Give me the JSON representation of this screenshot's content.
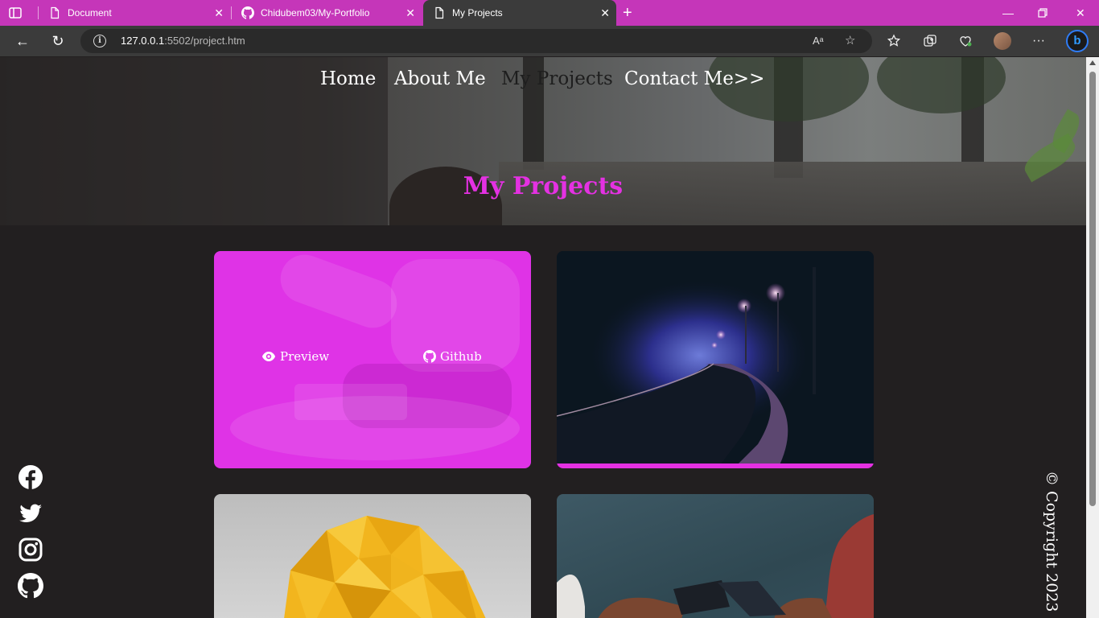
{
  "browser": {
    "tabs": [
      {
        "title": "Document",
        "icon": "document-icon"
      },
      {
        "title": "Chidubem03/My-Portfolio",
        "icon": "github-icon"
      },
      {
        "title": "My Projects",
        "icon": "document-icon",
        "active": true
      }
    ],
    "tab_close_glyph": "✕",
    "new_tab_glyph": "+",
    "url_host": "127.0.0.1",
    "url_rest": ":5502/project.htm",
    "accent_color": "#c536b9"
  },
  "site": {
    "nav": [
      {
        "label": "Home"
      },
      {
        "label": "About Me"
      },
      {
        "label": "My Projects",
        "current": true
      },
      {
        "label": "Contact Me>>"
      }
    ],
    "page_title": "My Projects",
    "accent_color": "#e431e2",
    "projects": [
      {
        "preview_label": "Preview",
        "github_label": "Github",
        "state": "hover"
      },
      {
        "image": "night-road"
      },
      {
        "image": "yellow-origami"
      },
      {
        "image": "hands-smartphone"
      }
    ],
    "socials": [
      "facebook-icon",
      "twitter-icon",
      "instagram-icon",
      "github-icon"
    ],
    "copyright": "© Copyright 2023"
  }
}
